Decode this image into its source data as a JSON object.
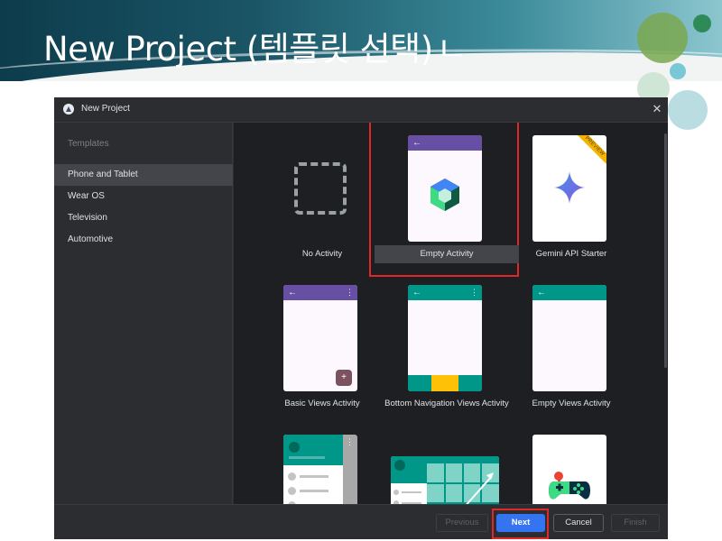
{
  "slide": {
    "title": "New Project (템플릿 선택)",
    "title_suffix": "ㄴ"
  },
  "dialog": {
    "title": "New Project",
    "close_glyph": "✕"
  },
  "sidebar": {
    "header": "Templates",
    "items": [
      {
        "label": "Phone and Tablet",
        "selected": true
      },
      {
        "label": "Wear OS",
        "selected": false
      },
      {
        "label": "Television",
        "selected": false
      },
      {
        "label": "Automotive",
        "selected": false
      }
    ]
  },
  "templates": [
    {
      "label": "No Activity",
      "icon": "dashed-square-icon"
    },
    {
      "label": "Empty Activity",
      "icon": "jetpack-compose-icon",
      "selected": true
    },
    {
      "label": "Gemini API Starter",
      "icon": "gemini-sparkle-icon",
      "badge": "PREVIEW"
    },
    {
      "label": "Basic Views Activity",
      "icon": "fab-plus-icon",
      "fab_glyph": "+"
    },
    {
      "label": "Bottom Navigation Views Activity",
      "icon": "bottom-nav-icon"
    },
    {
      "label": "Empty Views Activity",
      "icon": "blank-screen-icon"
    },
    {
      "label": "",
      "icon": "navigation-drawer-icon"
    },
    {
      "label": "",
      "icon": "responsive-grid-icon"
    },
    {
      "label": "",
      "icon": "game-controller-icon"
    }
  ],
  "footer": {
    "previous": "Previous",
    "next": "Next",
    "cancel": "Cancel",
    "finish": "Finish"
  },
  "colors": {
    "accent_blue": "#3574f0",
    "highlight_red": "#e0282a",
    "purple_bar": "#6750a4",
    "teal_bar": "#009688"
  }
}
